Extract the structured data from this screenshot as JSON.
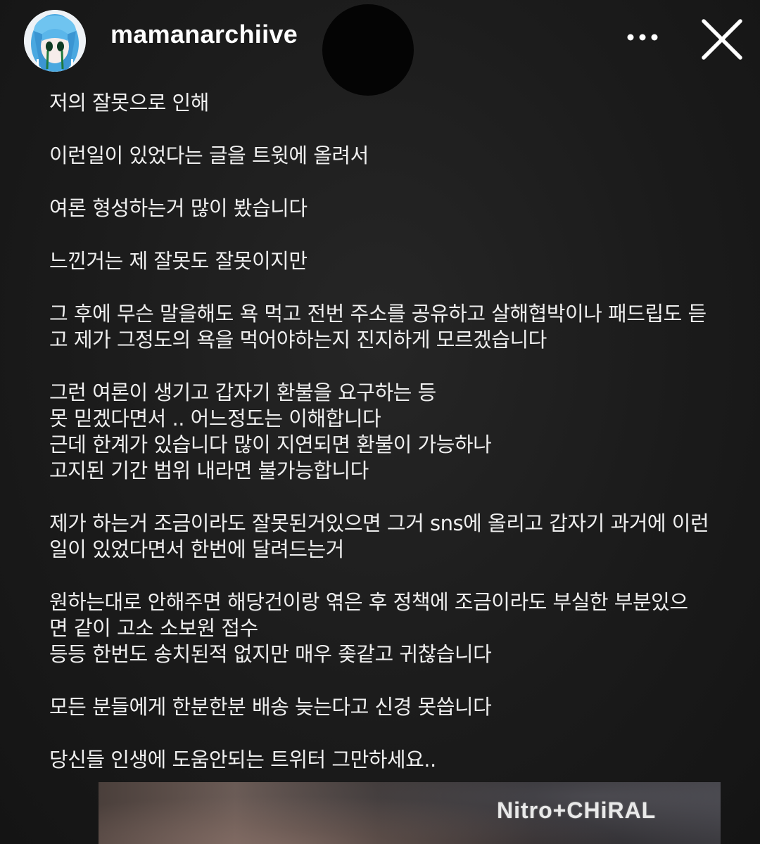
{
  "header": {
    "username": "mamanarchiive",
    "avatar_icon": "anime-character-avatar",
    "more_icon": "more-horizontal-icon",
    "close_icon": "close-icon"
  },
  "post": {
    "paragraphs": [
      [
        "저의 잘못으로 인해"
      ],
      [
        "이런일이 있었다는 글을 트윗에 올려서"
      ],
      [
        "여론 형성하는거 많이 봤습니다"
      ],
      [
        "느낀거는 제 잘못도 잘못이지만"
      ],
      [
        "그 후에 무슨 말을해도 욕 먹고 전번 주소를 공유하고 살해협박이나 패드립도 듣",
        "고 제가 그정도의 욕을 먹어야하는지 진지하게 모르겠습니다"
      ],
      [
        "그런 여론이 생기고 갑자기 환불을 요구하는 등",
        "못 믿겠다면서 .. 어느정도는 이해합니다",
        "근데 한계가 있습니다 많이 지연되면 환불이 가능하나",
        "고지된 기간 범위 내라면 불가능합니다"
      ],
      [
        "제가 하는거 조금이라도 잘못된거있으면 그거 sns에 올리고 갑자기 과거에 이런",
        "일이 있었다면서 한번에 달려드는거"
      ],
      [
        "원하는대로 안해주면 해당건이랑 엮은 후 정책에 조금이라도 부실한 부분있으",
        "면 같이 고소 소보원 접수",
        "등등 한번도 송치된적 없지만 매우 좆같고 귀찮습니다"
      ],
      [
        "모든 분들에게 한분한분 배송 늦는다고 신경 못씁니다"
      ],
      [
        "당신들 인생에 도움안되는 트위터 그만하세요.."
      ]
    ]
  },
  "bottom_image": {
    "brand_text": "Nitro+CHiRAL"
  },
  "colors": {
    "background": "#1b1b1b",
    "text": "#efefef",
    "username": "#ffffff"
  }
}
